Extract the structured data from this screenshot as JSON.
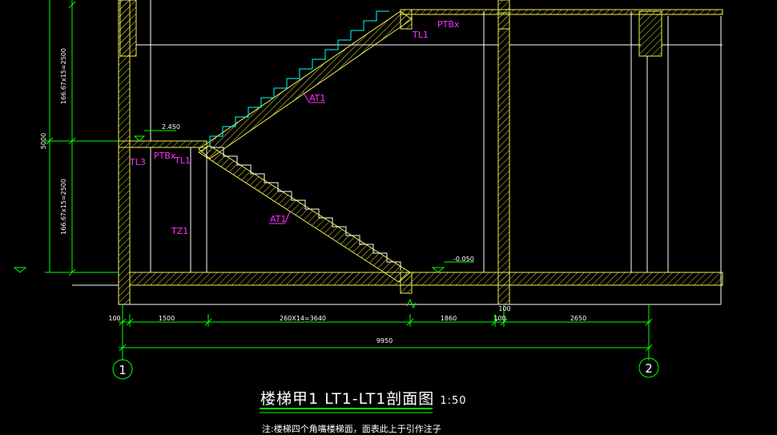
{
  "drawing": {
    "title": "楼梯甲1 LT1-LT1剖面图",
    "scale": "1:50",
    "note": "注:楼梯四个角嘴楼梯面，面表此上于引作注子"
  },
  "elevations": {
    "landing": "2.450",
    "ground": "-0.050"
  },
  "labels": {
    "at1_upper": "AT1",
    "at1_lower": "AT1",
    "tl1_upper": "TL1",
    "ptb_upper": "PTBx",
    "tl3": "TL3",
    "ptb_lower": "PTBx",
    "tl1_lower": "TL1",
    "tz1": "TZ1"
  },
  "dimensions": {
    "vertical_upper": "166.67x15=2500",
    "vertical_total": "5000",
    "vertical_lower": "166.67x15=2500",
    "d100_left": "100",
    "d1500": "1500",
    "d_run": "260X14=3640",
    "d1860": "1860",
    "d100_mid_a": "100",
    "d100_mid_b": "100",
    "d100_top": "100",
    "d2650": "2650",
    "total": "9950"
  },
  "grid_axes": {
    "axis1": "1",
    "axis2": "2"
  },
  "colors": {
    "wall": "#f0f050",
    "line": "#ffffff",
    "dim": "#00ff00",
    "tag": "#ff30ff",
    "stair": "#00ffff",
    "bg": "#000000"
  }
}
